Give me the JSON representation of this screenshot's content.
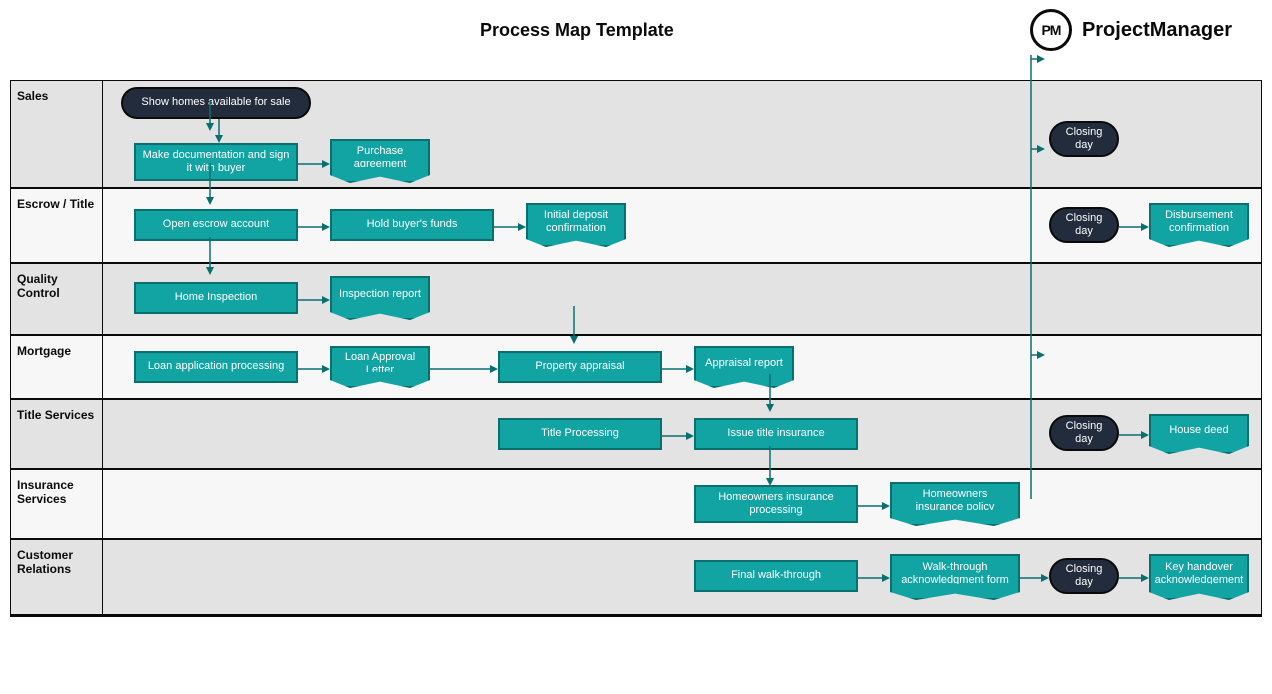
{
  "header": {
    "title": "Process Map Template",
    "brand_abbr": "PM",
    "brand_name": "ProjectManager"
  },
  "lanes": {
    "sales": "Sales",
    "escrow": "Escrow / Title",
    "quality": "Quality Control",
    "mortgage": "Mortgage",
    "title": "Title Services",
    "insurance": "Insurance Services",
    "customer": "Customer Relations"
  },
  "nodes": {
    "show_homes": "Show homes available for sale",
    "make_doc": "Make documentation and sign it with buyer",
    "purchase_agreement": "Purchase agreement",
    "open_escrow": "Open escrow account",
    "hold_funds": "Hold buyer's funds",
    "initial_deposit": "Initial deposit confirmation",
    "closing_day": "Closing day",
    "disbursement": "Disbursement confirmation",
    "home_inspection": "Home Inspection",
    "inspection_report": "Inspection report",
    "loan_processing": "Loan application processing",
    "loan_approval": "Loan Approval Letter",
    "property_appraisal": "Property appraisal",
    "appraisal_report": "Appraisal report",
    "title_processing": "Title Processing",
    "issue_title_ins": "Issue title insurance",
    "house_deed": "House deed",
    "homeowners_proc": "Homeowners insurance processing",
    "homeowners_policy": "Homeowners insurance policy",
    "final_walk": "Final walk-through",
    "walk_ack": "Walk-through acknowledgment form",
    "key_handover": "Key handover acknowledgement"
  }
}
